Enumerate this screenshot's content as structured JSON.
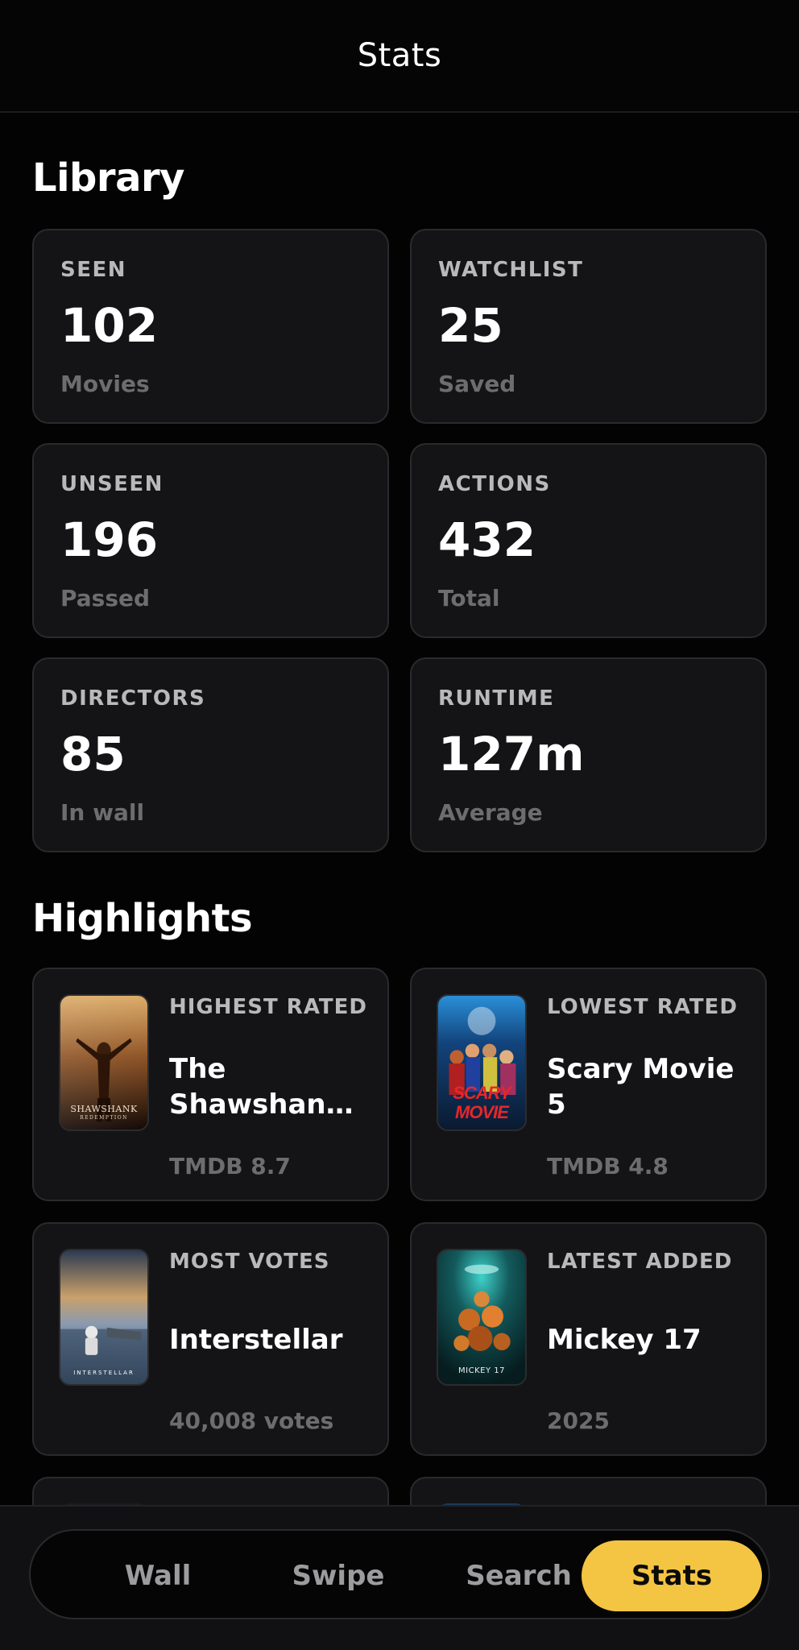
{
  "header": {
    "title": "Stats"
  },
  "library": {
    "title": "Library",
    "cards": [
      {
        "label": "SEEN",
        "value": "102",
        "sub": "Movies"
      },
      {
        "label": "WATCHLIST",
        "value": "25",
        "sub": "Saved"
      },
      {
        "label": "UNSEEN",
        "value": "196",
        "sub": "Passed"
      },
      {
        "label": "ACTIONS",
        "value": "432",
        "sub": "Total"
      },
      {
        "label": "DIRECTORS",
        "value": "85",
        "sub": "In wall"
      },
      {
        "label": "RUNTIME",
        "value": "127m",
        "sub": "Average"
      }
    ]
  },
  "highlights": {
    "title": "Highlights",
    "cards": [
      {
        "label": "HIGHEST RATED",
        "title": "The Shawshan…",
        "meta": "TMDB 8.7",
        "poster_text": "SHAWSHANK",
        "poster_subtext": "REDEMPTION"
      },
      {
        "label": "LOWEST RATED",
        "title": "Scary Movie 5",
        "meta": "TMDB 4.8",
        "poster_text": "SCARY",
        "poster_subtext": "MOVIE"
      },
      {
        "label": "MOST VOTES",
        "title": "Interstellar",
        "meta": "40,008 votes",
        "poster_text": "INTERSTELLAR"
      },
      {
        "label": "LATEST ADDED",
        "title": "Mickey 17",
        "meta": "2025",
        "poster_text": "MICKEY 17"
      }
    ]
  },
  "nav": {
    "items": [
      {
        "label": "Wall"
      },
      {
        "label": "Swipe"
      },
      {
        "label": "Search"
      },
      {
        "label": "Stats"
      }
    ],
    "active": "Stats"
  },
  "colors": {
    "background": "#030303",
    "card": "#141416",
    "accent": "#f4c542",
    "muted": "#6d6d70"
  }
}
